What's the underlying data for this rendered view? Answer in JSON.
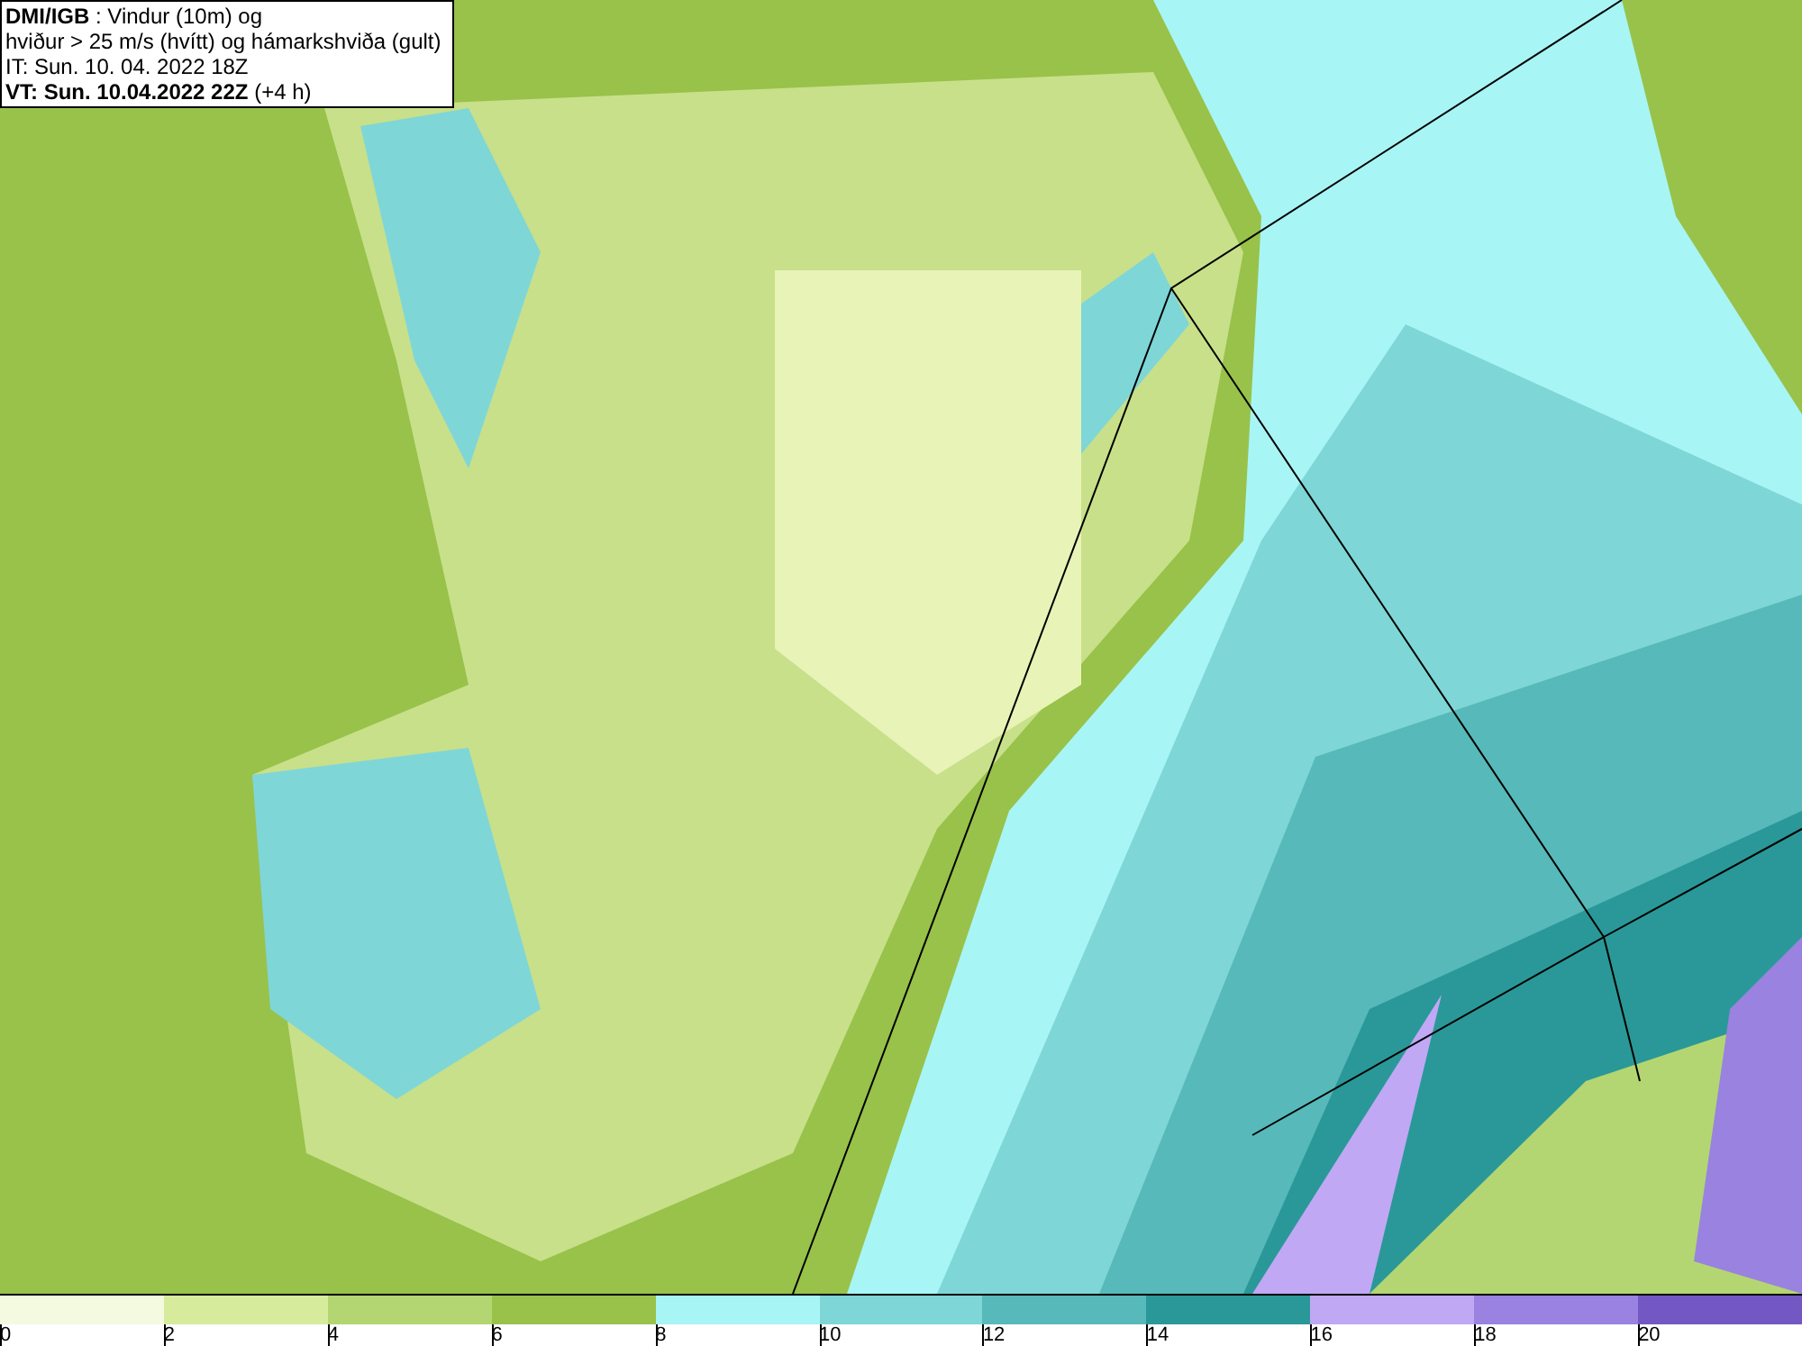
{
  "header": {
    "lines": [
      "**DMI/IGB** : Vindur (10m) og",
      "hviður > 25 m/s (hvítt) og hámarkshviða (gult)",
      "IT: Sun. 10. 04. 2022 18Z",
      "**VT: Sun. 10.04.2022 22Z** (+4 h)"
    ]
  },
  "legend": {
    "segments": [
      {
        "color": "#f4fadf"
      },
      {
        "color": "#d6eb9c"
      },
      {
        "color": "#b3d672"
      },
      {
        "color": "#98c24a"
      },
      {
        "color": "#a8f5f5"
      },
      {
        "color": "#7fd6d6"
      },
      {
        "color": "#57b9b9"
      },
      {
        "color": "#2a9898"
      },
      {
        "color": "#c0a8f5"
      },
      {
        "color": "#9a82e0"
      },
      {
        "color": "#7358c4"
      }
    ],
    "labels": [
      "0",
      "2",
      "4",
      "6",
      "8",
      "10",
      "12",
      "14",
      "16",
      "18",
      "20"
    ]
  }
}
